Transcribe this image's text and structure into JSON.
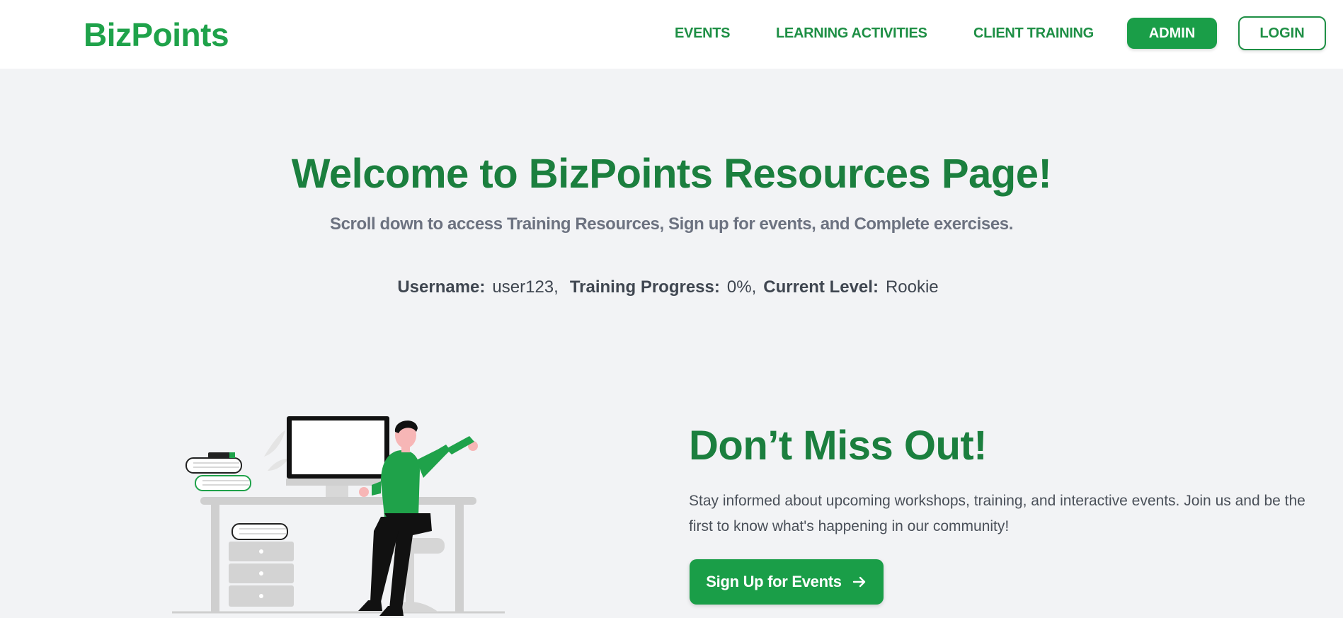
{
  "brand": {
    "logo": "BizPoints",
    "accent": "#1fa24a",
    "dark_green": "#1b7f3e"
  },
  "nav": {
    "links": [
      {
        "label": "EVENTS"
      },
      {
        "label": "LEARNING ACTIVITIES"
      },
      {
        "label": "CLIENT TRAINING"
      }
    ],
    "admin_label": "ADMIN",
    "login_label": "LOGIN"
  },
  "hero": {
    "title": "Welcome to BizPoints Resources Page!",
    "subtitle": "Scroll down to access Training Resources, Sign up for events, and Complete exercises."
  },
  "stats": {
    "username_label": "Username:",
    "username_value": "user123,",
    "progress_label": "Training Progress:",
    "progress_value": "0%,",
    "level_label": "Current Level:",
    "level_value": "Rookie"
  },
  "promo": {
    "title": "Don’t Miss Out!",
    "text": "Stay informed about upcoming workshops, training, and interactive events. Join us and be the first to know what's happening in our community!",
    "button_label": "Sign Up for Events",
    "button_icon": "arrow-right-icon",
    "illustration": "person-at-desk-illustration"
  }
}
